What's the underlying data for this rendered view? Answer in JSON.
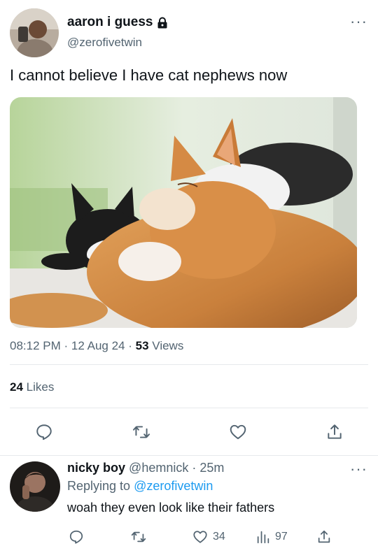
{
  "tweet": {
    "author_name": "aaron i guess",
    "author_handle": "@zerofivetwin",
    "text": "I cannot believe I have cat nephews now",
    "time": "08:12 PM",
    "date": "12 Aug 24",
    "views_count": "53",
    "views_label": "Views",
    "likes_count": "24",
    "likes_label": "Likes",
    "image_icon": "photo-of-two-sleeping-cats",
    "lock_icon": "lock-icon"
  },
  "reply": {
    "author_name": "nicky boy",
    "author_handle": "@hemnick",
    "time_ago": "25m",
    "replying_prefix": "Replying to",
    "replying_to": "@zerofivetwin",
    "text": "woah they even look like their fathers",
    "like_count": "34",
    "views_count": "97"
  },
  "separators": {
    "dot": "·"
  },
  "colors": {
    "accent": "#1d9bf0",
    "muted": "#536471",
    "text": "#0f1419"
  }
}
